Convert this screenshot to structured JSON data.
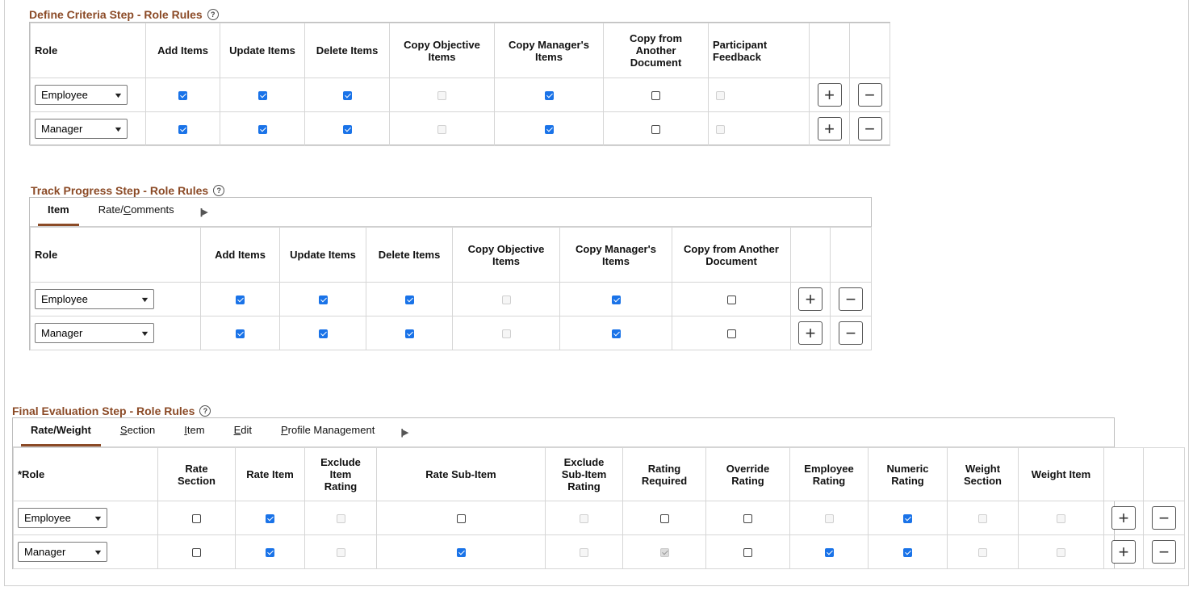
{
  "define": {
    "title": "Define Criteria Step - Role Rules",
    "columns": {
      "role": "Role",
      "add": "Add Items",
      "update": "Update Items",
      "delete": "Delete Items",
      "copy_obj_1": "Copy Objective",
      "copy_obj_2": "Items",
      "copy_mgr_1": "Copy Manager's",
      "copy_mgr_2": "Items",
      "copy_another_1": "Copy from",
      "copy_another_2": "Another",
      "copy_another_3": "Document",
      "feedback_1": "Participant",
      "feedback_2": "Feedback"
    },
    "rows": [
      {
        "role": "Employee",
        "add": "on",
        "update": "on",
        "delete": "on",
        "copy_obj": "dis",
        "copy_mgr": "on",
        "copy_another": "off",
        "feedback": "dis"
      },
      {
        "role": "Manager",
        "add": "on",
        "update": "on",
        "delete": "on",
        "copy_obj": "dis",
        "copy_mgr": "on",
        "copy_another": "off",
        "feedback": "dis"
      }
    ]
  },
  "track": {
    "title": "Track Progress Step - Role Rules",
    "tabs": {
      "item": "Item",
      "rate_pre": "Rate/",
      "rate_ul": "C",
      "rate_post": "omments"
    },
    "columns": {
      "role": "Role",
      "add": "Add Items",
      "update": "Update Items",
      "delete": "Delete Items",
      "copy_obj_1": "Copy Objective",
      "copy_obj_2": "Items",
      "copy_mgr_1": "Copy Manager's",
      "copy_mgr_2": "Items",
      "copy_another_1": "Copy from Another",
      "copy_another_2": "Document"
    },
    "rows": [
      {
        "role": "Employee",
        "add": "on",
        "update": "on",
        "delete": "on",
        "copy_obj": "dis",
        "copy_mgr": "on",
        "copy_another": "off"
      },
      {
        "role": "Manager",
        "add": "on",
        "update": "on",
        "delete": "on",
        "copy_obj": "dis",
        "copy_mgr": "on",
        "copy_another": "off"
      }
    ]
  },
  "final": {
    "title": "Final Evaluation Step - Role Rules",
    "tabs": {
      "rate_weight": "Rate/Weight",
      "section_ul": "S",
      "section_rest": "ection",
      "item_ul": "I",
      "item_rest": "tem",
      "edit_ul": "E",
      "edit_rest": "dit",
      "profile_ul": "P",
      "profile_rest": "rofile Management"
    },
    "columns": {
      "role": "*Role",
      "rate_section_1": "Rate",
      "rate_section_2": "Section",
      "rate_item": "Rate Item",
      "excl_item_1": "Exclude",
      "excl_item_2": "Item",
      "excl_item_3": "Rating",
      "rate_sub": "Rate Sub-Item",
      "excl_sub_1": "Exclude",
      "excl_sub_2": "Sub-Item",
      "excl_sub_3": "Rating",
      "rating_req_1": "Rating",
      "rating_req_2": "Required",
      "override_1": "Override",
      "override_2": "Rating",
      "emp_rating_1": "Employee",
      "emp_rating_2": "Rating",
      "numeric_1": "Numeric",
      "numeric_2": "Rating",
      "weight_sec_1": "Weight",
      "weight_sec_2": "Section",
      "weight_item": "Weight Item"
    },
    "rows": [
      {
        "role": "Employee",
        "rate_section": "off",
        "rate_item": "on",
        "excl_item": "dis",
        "rate_sub": "off",
        "excl_sub": "dis",
        "rating_req": "off",
        "override": "off",
        "emp_rating": "dis",
        "numeric": "on",
        "weight_sec": "dis",
        "weight_item": "dis"
      },
      {
        "role": "Manager",
        "rate_section": "off",
        "rate_item": "on",
        "excl_item": "dis",
        "rate_sub": "on",
        "excl_sub": "dis",
        "rating_req": "dison",
        "override": "off",
        "emp_rating": "on",
        "numeric": "on",
        "weight_sec": "dis",
        "weight_item": "dis"
      }
    ]
  },
  "icons": {
    "help": "?",
    "add": "+",
    "remove": "−",
    "chevron": "▼",
    "more_tabs": "||▶"
  }
}
